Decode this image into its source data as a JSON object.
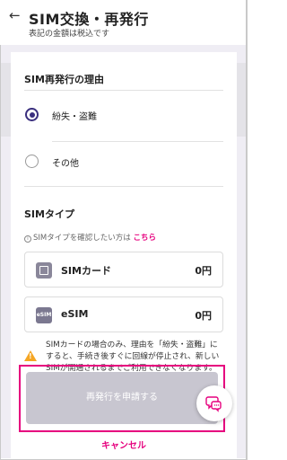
{
  "header": {
    "back_glyph": "←",
    "title": "SIM交換・再発行",
    "subtitle": "表記の金額は税込です"
  },
  "reason": {
    "title": "SIM再発行の理由",
    "options": [
      {
        "label": "紛失・盗難",
        "selected": true
      },
      {
        "label": "その他",
        "selected": false
      }
    ]
  },
  "sim_type": {
    "title": "SIMタイプ",
    "info_text": "SIMタイプを確認したい方は",
    "info_link": "こちら",
    "options": [
      {
        "icon": "sim-card-icon",
        "name": "SIMカード",
        "price": "0円"
      },
      {
        "icon": "esim-icon",
        "icon_text": "eSIM",
        "name": "eSIM",
        "price": "0円"
      }
    ]
  },
  "notice": {
    "text": "SIMカードの場合のみ、理由を「紛失・盗難」にすると、手続き後すぐに回線が停止され、新しいSIMが開通されるまでご利用できなくなります。"
  },
  "actions": {
    "apply_label": "再発行を申請する",
    "cancel_label": "キャンセル"
  },
  "colors": {
    "accent": "#e6007e",
    "radio": "#3a2f7e",
    "button_disabled": "#c8c6d0",
    "warning": "#f5a623"
  }
}
